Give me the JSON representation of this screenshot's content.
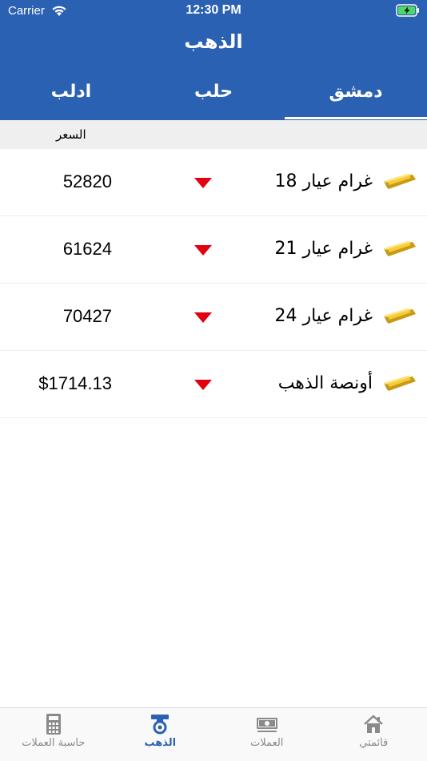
{
  "status_bar": {
    "carrier": "Carrier",
    "time": "12:30 PM"
  },
  "nav": {
    "title": "الذهب"
  },
  "tabs": [
    {
      "label": "دمشق",
      "active": true
    },
    {
      "label": "حلب",
      "active": false
    },
    {
      "label": "ادلب",
      "active": false
    }
  ],
  "columns": {
    "price": "السعر"
  },
  "rows": [
    {
      "label": "غرام عيار 18",
      "price": "52820",
      "trend": "down"
    },
    {
      "label": "غرام عيار 21",
      "price": "61624",
      "trend": "down"
    },
    {
      "label": "غرام عيار 24",
      "price": "70427",
      "trend": "down"
    },
    {
      "label": "أونصة الذهب",
      "price": "$1714.13",
      "trend": "down"
    }
  ],
  "tabbar": [
    {
      "label": "قائمتي",
      "icon": "home-icon",
      "active": false
    },
    {
      "label": "العملات",
      "icon": "banknote-icon",
      "active": false
    },
    {
      "label": "الذهب",
      "icon": "gold-ring-icon",
      "active": true
    },
    {
      "label": "حاسبة العملات",
      "icon": "calculator-icon",
      "active": false
    }
  ],
  "colors": {
    "brand": "#2b61b3",
    "trend_down": "#e3000f",
    "gold": "#f2c230",
    "inactive": "#8a8a8a"
  }
}
